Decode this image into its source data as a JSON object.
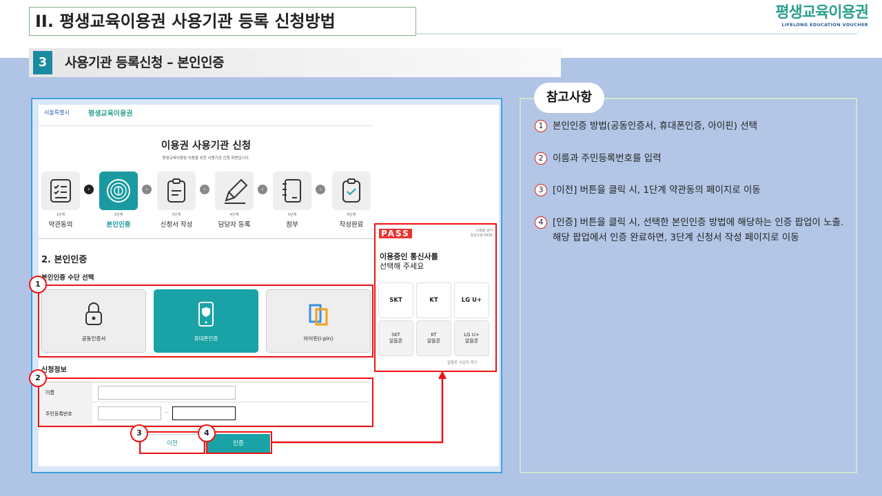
{
  "header": {
    "title": "II. 평생교육이용권 사용기관 등록 신청방법",
    "brand_main": "평생교육이용권",
    "brand_sub": "LIFELONG EDUCATION VOUCHER",
    "section_num": "3",
    "section_title": "사용기관 등록신청 – 본인인증"
  },
  "screenshot": {
    "logo_city": "서울특별시",
    "logo_voucher": "평생교육이용권",
    "page_title": "이용권 사용기관 신청",
    "page_subtitle": "평생교육이용권 이용을 위한 사용기관 신청 화면입니다.",
    "steps": [
      {
        "num": "1단계",
        "label": "약관동의"
      },
      {
        "num": "2단계",
        "label": "본인인증"
      },
      {
        "num": "3단계",
        "label": "신청서 작성"
      },
      {
        "num": "4단계",
        "label": "담당자 등록"
      },
      {
        "num": "5단계",
        "label": "첨부"
      },
      {
        "num": "6단계",
        "label": "작성완료"
      }
    ],
    "section_heading": "2. 본인인증",
    "method_heading": "본인인증 수단 선택",
    "methods": [
      {
        "label": "공동인증서"
      },
      {
        "label": "휴대폰인증"
      },
      {
        "label": "아이핀(i-pin)"
      }
    ],
    "info_heading": "신청정보",
    "fields": [
      {
        "label": "이름",
        "value": ""
      },
      {
        "label": "주민등록번호",
        "value": "",
        "separator": "-"
      }
    ],
    "prev_button": "이전",
    "auth_button": "인증"
  },
  "pass_popup": {
    "logo": "PASS",
    "note_line1": "인증을 넘어",
    "note_line2": "일상으로 PASS",
    "title_line1": "이용중인 통신사를",
    "title_line2": "선택해 주세요",
    "carriers": [
      "SKT",
      "KT",
      "LG U+"
    ],
    "mvno": [
      {
        "line1": "SKT",
        "line2": "알뜰폰"
      },
      {
        "line1": "KT",
        "line2": "알뜰폰"
      },
      {
        "line1": "LG U+",
        "line2": "알뜰폰"
      }
    ],
    "footer": "알뜰폰 사업자 확인"
  },
  "annotations": [
    "1",
    "2",
    "3",
    "4"
  ],
  "notes": {
    "badge": "참고사항",
    "items": [
      {
        "num": "1",
        "text": "본인인증 방법(공동인증서, 휴대폰인증, 아이핀) 선택"
      },
      {
        "num": "2",
        "text": "이름과 주민등록번호를 입력"
      },
      {
        "num": "3",
        "text": "[이전] 버튼을 클릭 시, 1단계 약관동의 페이지로 이동"
      },
      {
        "num": "4",
        "text": "[인증] 버튼을 클릭 시, 선택한 본인인증 방법에 해당하는 인증 팝업이 노출.",
        "text2": "해당 팝업에서 인증 완료하면, 3단계 신청서 작성 페이지로 이동"
      }
    ]
  },
  "colors": {
    "accent": "#1aa3a6",
    "annotation": "#e11111",
    "background": "#b0c4e6"
  }
}
